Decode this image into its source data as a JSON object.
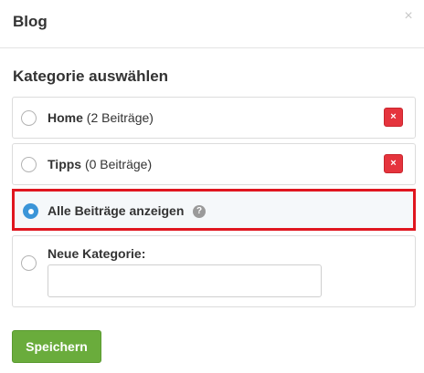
{
  "header": {
    "title": "Blog",
    "close_glyph": "×"
  },
  "section": {
    "title": "Kategorie auswählen"
  },
  "options": [
    {
      "name": "Home",
      "count": "(2 Beiträge)",
      "delete_glyph": "×",
      "checked": false
    },
    {
      "name": "Tipps",
      "count": "(0 Beiträge)",
      "delete_glyph": "×",
      "checked": false
    },
    {
      "name": "Alle Beiträge anzeigen",
      "help_glyph": "?",
      "checked": true
    }
  ],
  "new_category": {
    "label": "Neue Kategorie:",
    "value": "",
    "placeholder": "",
    "checked": false
  },
  "save_button": {
    "label": "Speichern"
  },
  "colors": {
    "accent_radio": "#3b95d8",
    "delete_red": "#e5343d",
    "highlight_border": "#e0161f",
    "save_green": "#6aac3c"
  },
  "icons": {
    "close": "close-icon",
    "delete": "delete-icon",
    "help": "help-icon"
  }
}
